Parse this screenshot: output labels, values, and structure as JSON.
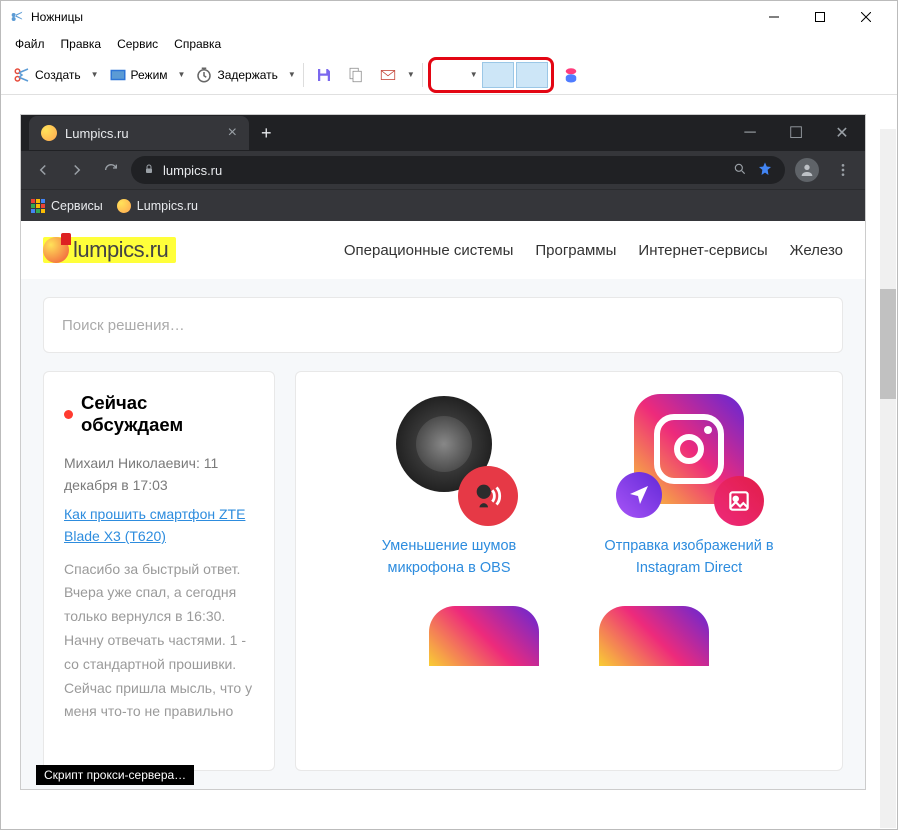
{
  "app": {
    "title": "Ножницы",
    "menu": {
      "file": "Файл",
      "edit": "Правка",
      "tools": "Сервис",
      "help": "Справка"
    },
    "toolbar": {
      "new_label": "Создать",
      "mode_label": "Режим",
      "delay_label": "Задержать"
    }
  },
  "browser": {
    "tab_title": "Lumpics.ru",
    "url": "lumpics.ru",
    "bookmarks": {
      "apps": "Сервисы",
      "site": "Lumpics.ru"
    }
  },
  "site": {
    "logo_text": "lumpics.ru",
    "nav": {
      "os": "Операционные системы",
      "programs": "Программы",
      "services": "Интернет-сервисы",
      "hardware": "Железо"
    },
    "search_placeholder": "Поиск решения…",
    "discuss": {
      "title": "Сейчас обсуждаем",
      "meta": "Михаил Николаевич: 11 декабря в 17:03",
      "link": "Как прошить смартфон ZTE Blade X3 (T620)",
      "body": "Спасибо за быстрый ответ. Вчера уже спал, а сегодня только вернулся в 16:30. Начну отвечать частями. 1 - со стандартной прошивки. Сейчас пришла мысль, что у меня что-то не правильно"
    },
    "articles": [
      {
        "title": "Уменьшение шумов микрофона в OBS"
      },
      {
        "title": "Отправка изображений в Instagram Direct"
      }
    ]
  },
  "tooltip": "Скрипт прокси-сервера…"
}
